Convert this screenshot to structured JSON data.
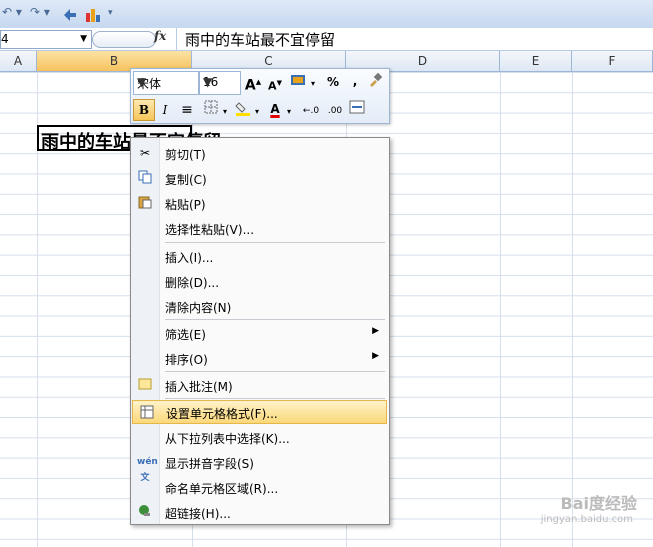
{
  "formula_bar": {
    "name_box": "4",
    "fx_label": "fx",
    "content": "雨中的车站最不宜停留"
  },
  "columns": [
    "A",
    "B",
    "C",
    "D",
    "E",
    "F"
  ],
  "cell_text": "雨中的车站最不宜停留",
  "mini_toolbar": {
    "font_name": "宋体",
    "font_size": "16",
    "grow_font": "A",
    "shrink_font": "A",
    "percent": "%",
    "comma": ",",
    "bold": "B",
    "italic": "I",
    "font_color": "A"
  },
  "context_menu": {
    "items": [
      {
        "label": "剪切(T)",
        "icon": "scissors-icon"
      },
      {
        "label": "复制(C)",
        "icon": "copy-icon"
      },
      {
        "label": "粘贴(P)",
        "icon": "paste-icon"
      },
      {
        "label": "选择性粘贴(V)..."
      },
      {
        "label": "插入(I)..."
      },
      {
        "label": "删除(D)..."
      },
      {
        "label": "清除内容(N)"
      },
      {
        "label": "筛选(E)",
        "submenu": true
      },
      {
        "label": "排序(O)",
        "submenu": true
      },
      {
        "label": "插入批注(M)",
        "icon": "comment-icon"
      },
      {
        "label": "设置单元格格式(F)...",
        "icon": "format-cells-icon",
        "highlighted": true
      },
      {
        "label": "从下拉列表中选择(K)..."
      },
      {
        "label": "显示拼音字段(S)",
        "icon": "phonetic-icon"
      },
      {
        "label": "命名单元格区域(R)..."
      },
      {
        "label": "超链接(H)...",
        "icon": "hyperlink-icon"
      }
    ]
  },
  "watermark": {
    "text": "Bai度经验",
    "url_text": "jingyan.baidu.com"
  },
  "colors": {
    "ribbon_blue": "#c6d8ef",
    "selection_orange": "#f6c25e",
    "highlight": "#fbd87a"
  }
}
